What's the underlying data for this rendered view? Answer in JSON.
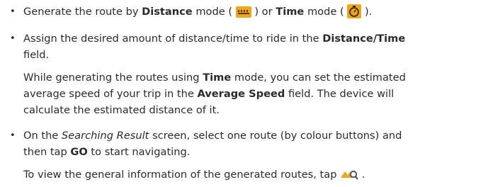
{
  "items": [
    {
      "bullet": "•",
      "parts": {
        "a": "Generate the route by ",
        "b": "Distance",
        "c": " mode ( ",
        "d": " ) or ",
        "e": "Time",
        "f": " mode ( ",
        "g": " )."
      }
    },
    {
      "bullet": "•",
      "line1": {
        "a": "Assign the desired amount of distance/time to ride in the ",
        "b": "Distance",
        "c": "/",
        "d": "Time"
      },
      "line2": "field.",
      "para": {
        "l1a": "While generating the routes using ",
        "l1b": "Time",
        "l1c": " mode, you can set the estimated",
        "l2a": "average speed of your trip in the ",
        "l2b": "Average Speed",
        "l2c": " field. The device will",
        "l3": "calculate the estimated distance of it."
      }
    },
    {
      "bullet": "•",
      "line1": {
        "a": "On the ",
        "b": "Searching Result",
        "c": " screen, select one route (by colour buttons) and"
      },
      "line2": {
        "a": "then tap ",
        "b": "GO",
        "c": " to start navigating."
      },
      "para": {
        "a": "To view the general information of the generated routes, tap ",
        "b": " ."
      }
    }
  ],
  "icons": {
    "distance": "ruler-icon",
    "time": "timer-icon",
    "overview": "route-overview-icon",
    "accent": "#f1a51b"
  }
}
